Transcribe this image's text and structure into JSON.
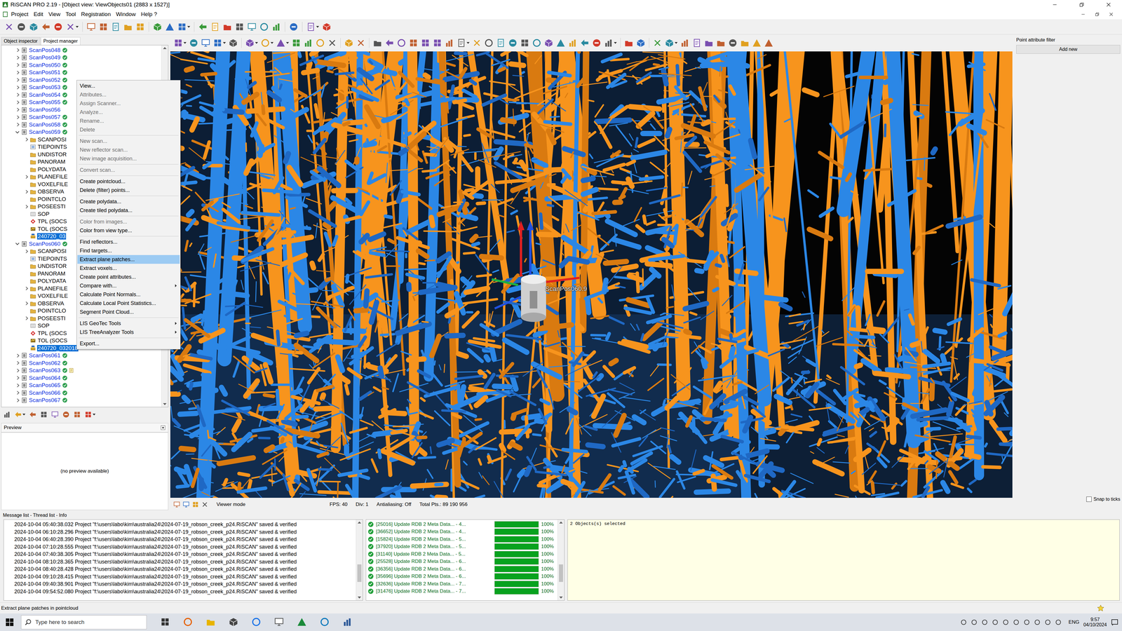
{
  "window": {
    "title": "RiSCAN PRO 2.19 - [Object view: ViewObjects01 (2883 x 1527)]"
  },
  "menu": [
    "Project",
    "Edit",
    "View",
    "Tool",
    "Registration",
    "Window",
    "Help ?"
  ],
  "left_tabs": [
    {
      "label": "Object inspector",
      "selected": false
    },
    {
      "label": "Project manager",
      "selected": true
    }
  ],
  "tree": [
    {
      "label": "ScanPos048",
      "depth": 0,
      "kind": "scanpos",
      "expandable": true,
      "expanded": false,
      "selected": false,
      "registered": true,
      "annotated": false
    },
    {
      "label": "ScanPos049",
      "depth": 0,
      "kind": "scanpos",
      "expandable": true,
      "expanded": false,
      "selected": false,
      "registered": true,
      "annotated": false
    },
    {
      "label": "ScanPos050",
      "depth": 0,
      "kind": "scanpos",
      "expandable": true,
      "expanded": false,
      "selected": false,
      "registered": true,
      "annotated": false
    },
    {
      "label": "ScanPos051",
      "depth": 0,
      "kind": "scanpos",
      "expandable": true,
      "expanded": false,
      "selected": false,
      "registered": true,
      "annotated": false
    },
    {
      "label": "ScanPos052",
      "depth": 0,
      "kind": "scanpos",
      "expandable": true,
      "expanded": false,
      "selected": false,
      "registered": true,
      "annotated": false
    },
    {
      "label": "ScanPos053",
      "depth": 0,
      "kind": "scanpos",
      "expandable": true,
      "expanded": false,
      "selected": false,
      "registered": true,
      "annotated": false
    },
    {
      "label": "ScanPos054",
      "depth": 0,
      "kind": "scanpos",
      "expandable": true,
      "expanded": false,
      "selected": false,
      "registered": true,
      "annotated": false
    },
    {
      "label": "ScanPos055",
      "depth": 0,
      "kind": "scanpos",
      "expandable": true,
      "expanded": false,
      "selected": false,
      "registered": true,
      "annotated": false
    },
    {
      "label": "ScanPos056",
      "depth": 0,
      "kind": "scanpos",
      "expandable": true,
      "expanded": false,
      "selected": false,
      "registered": false,
      "annotated": false
    },
    {
      "label": "ScanPos057",
      "depth": 0,
      "kind": "scanpos",
      "expandable": true,
      "expanded": false,
      "selected": false,
      "registered": true,
      "annotated": false
    },
    {
      "label": "ScanPos058",
      "depth": 0,
      "kind": "scanpos",
      "expandable": true,
      "expanded": false,
      "selected": false,
      "registered": true,
      "annotated": false
    },
    {
      "label": "ScanPos059",
      "depth": 0,
      "kind": "scanpos",
      "expandable": true,
      "expanded": true,
      "selected": false,
      "registered": true,
      "annotated": false
    },
    {
      "label": "SCANPOSI",
      "depth": 1,
      "kind": "folder",
      "expandable": true,
      "expanded": false,
      "selected": false
    },
    {
      "label": "TIEPOINTS",
      "depth": 1,
      "kind": "list",
      "expandable": false,
      "expanded": false,
      "selected": false
    },
    {
      "label": "UNDISTOR",
      "depth": 1,
      "kind": "folder",
      "expandable": false,
      "expanded": false,
      "selected": false
    },
    {
      "label": "PANORAM",
      "depth": 1,
      "kind": "folder",
      "expandable": false,
      "expanded": false,
      "selected": false
    },
    {
      "label": "POLYDATA",
      "depth": 1,
      "kind": "folder",
      "expandable": false,
      "expanded": false,
      "selected": false
    },
    {
      "label": "PLANEFILE",
      "depth": 1,
      "kind": "folder",
      "expandable": true,
      "expanded": false,
      "selected": false
    },
    {
      "label": "VOXELFILE",
      "depth": 1,
      "kind": "folder",
      "expandable": false,
      "expanded": false,
      "selected": false
    },
    {
      "label": "OBSERVA",
      "depth": 1,
      "kind": "folder",
      "expandable": true,
      "expanded": false,
      "selected": false
    },
    {
      "label": "POINTCLO",
      "depth": 1,
      "kind": "folder",
      "expandable": false,
      "expanded": false,
      "selected": false
    },
    {
      "label": "POSEESTI",
      "depth": 1,
      "kind": "folder",
      "expandable": true,
      "expanded": false,
      "selected": false
    },
    {
      "label": "SOP",
      "depth": 1,
      "kind": "matrix",
      "expandable": false,
      "expanded": false,
      "selected": false
    },
    {
      "label": "TPL (SOCS",
      "depth": 1,
      "kind": "tpl",
      "expandable": false,
      "expanded": false,
      "selected": false
    },
    {
      "label": "TOL (SOCS",
      "depth": 1,
      "kind": "tol",
      "expandable": false,
      "expanded": false,
      "selected": false
    },
    {
      "label": "240720_03",
      "depth": 1,
      "kind": "scan",
      "expandable": false,
      "expanded": false,
      "selected": true
    },
    {
      "label": "ScanPos060",
      "depth": 0,
      "kind": "scanpos",
      "expandable": true,
      "expanded": true,
      "selected": false,
      "registered": true,
      "annotated": false
    },
    {
      "label": "SCANPOSI",
      "depth": 1,
      "kind": "folder",
      "expandable": true,
      "expanded": false,
      "selected": false
    },
    {
      "label": "TIEPOINTS",
      "depth": 1,
      "kind": "list",
      "expandable": false,
      "expanded": false,
      "selected": false
    },
    {
      "label": "UNDISTOR",
      "depth": 1,
      "kind": "folder",
      "expandable": false,
      "expanded": false,
      "selected": false
    },
    {
      "label": "PANORAM",
      "depth": 1,
      "kind": "folder",
      "expandable": false,
      "expanded": false,
      "selected": false
    },
    {
      "label": "POLYDATA",
      "depth": 1,
      "kind": "folder",
      "expandable": false,
      "expanded": false,
      "selected": false
    },
    {
      "label": "PLANEFILE",
      "depth": 1,
      "kind": "folder",
      "expandable": true,
      "expanded": false,
      "selected": false
    },
    {
      "label": "VOXELFILE",
      "depth": 1,
      "kind": "folder",
      "expandable": false,
      "expanded": false,
      "selected": false
    },
    {
      "label": "OBSERVA",
      "depth": 1,
      "kind": "folder",
      "expandable": true,
      "expanded": false,
      "selected": false
    },
    {
      "label": "POINTCLO",
      "depth": 1,
      "kind": "folder",
      "expandable": false,
      "expanded": false,
      "selected": false
    },
    {
      "label": "POSEESTI",
      "depth": 1,
      "kind": "folder",
      "expandable": true,
      "expanded": false,
      "selected": false
    },
    {
      "label": "SOP",
      "depth": 1,
      "kind": "matrix",
      "expandable": false,
      "expanded": false,
      "selected": false
    },
    {
      "label": "TPL (SOCS",
      "depth": 1,
      "kind": "tpl",
      "expandable": false,
      "expanded": false,
      "selected": false
    },
    {
      "label": "TOL (SOCS",
      "depth": 1,
      "kind": "tol",
      "expandable": false,
      "expanded": false,
      "selected": false
    },
    {
      "label": "240720_032018",
      "depth": 1,
      "kind": "scan",
      "expandable": false,
      "expanded": false,
      "selected": true
    },
    {
      "label": "ScanPos061",
      "depth": 0,
      "kind": "scanpos",
      "expandable": true,
      "expanded": false,
      "selected": false,
      "registered": true,
      "annotated": false
    },
    {
      "label": "ScanPos062",
      "depth": 0,
      "kind": "scanpos",
      "expandable": true,
      "expanded": false,
      "selected": false,
      "registered": true,
      "annotated": false
    },
    {
      "label": "ScanPos063",
      "depth": 0,
      "kind": "scanpos",
      "expandable": true,
      "expanded": false,
      "selected": false,
      "registered": true,
      "annotated": true
    },
    {
      "label": "ScanPos064",
      "depth": 0,
      "kind": "scanpos",
      "expandable": true,
      "expanded": false,
      "selected": false,
      "registered": true,
      "annotated": false
    },
    {
      "label": "ScanPos065",
      "depth": 0,
      "kind": "scanpos",
      "expandable": true,
      "expanded": false,
      "selected": false,
      "registered": true,
      "annotated": false
    },
    {
      "label": "ScanPos066",
      "depth": 0,
      "kind": "scanpos",
      "expandable": true,
      "expanded": false,
      "selected": false,
      "registered": true,
      "annotated": false
    },
    {
      "label": "ScanPos067",
      "depth": 0,
      "kind": "scanpos",
      "expandable": true,
      "expanded": false,
      "selected": false,
      "registered": true,
      "annotated": false
    }
  ],
  "context_menu": [
    {
      "kind": "item",
      "label": "View...",
      "disabled": false,
      "selected": false,
      "submenu": false
    },
    {
      "kind": "item",
      "label": "Attributes...",
      "disabled": true,
      "selected": false,
      "submenu": false
    },
    {
      "kind": "item",
      "label": "Assign Scanner...",
      "disabled": true,
      "selected": false,
      "submenu": false
    },
    {
      "kind": "item",
      "label": "Analyze...",
      "disabled": true,
      "selected": false,
      "submenu": false
    },
    {
      "kind": "item",
      "label": "Rename...",
      "disabled": true,
      "selected": false,
      "submenu": false
    },
    {
      "kind": "item",
      "label": "Delete",
      "disabled": true,
      "selected": false,
      "submenu": false
    },
    {
      "kind": "separator"
    },
    {
      "kind": "item",
      "label": "New scan...",
      "disabled": true,
      "selected": false,
      "submenu": false
    },
    {
      "kind": "item",
      "label": "New reflector scan...",
      "disabled": true,
      "selected": false,
      "submenu": false
    },
    {
      "kind": "item",
      "label": "New image acquisition...",
      "disabled": true,
      "selected": false,
      "submenu": false
    },
    {
      "kind": "separator"
    },
    {
      "kind": "item",
      "label": "Convert scan...",
      "disabled": true,
      "selected": false,
      "submenu": false
    },
    {
      "kind": "separator"
    },
    {
      "kind": "item",
      "label": "Create pointcloud...",
      "disabled": false,
      "selected": false,
      "submenu": false
    },
    {
      "kind": "item",
      "label": "Delete (filter) points...",
      "disabled": false,
      "selected": false,
      "submenu": false
    },
    {
      "kind": "separator"
    },
    {
      "kind": "item",
      "label": "Create polydata...",
      "disabled": false,
      "selected": false,
      "submenu": false
    },
    {
      "kind": "item",
      "label": "Create tiled polydata...",
      "disabled": false,
      "selected": false,
      "submenu": false
    },
    {
      "kind": "separator"
    },
    {
      "kind": "item",
      "label": "Color from images...",
      "disabled": true,
      "selected": false,
      "submenu": false
    },
    {
      "kind": "item",
      "label": "Color from view type...",
      "disabled": false,
      "selected": false,
      "submenu": false
    },
    {
      "kind": "separator"
    },
    {
      "kind": "item",
      "label": "Find reflectors...",
      "disabled": false,
      "selected": false,
      "submenu": false
    },
    {
      "kind": "item",
      "label": "Find targets...",
      "disabled": false,
      "selected": false,
      "submenu": false
    },
    {
      "kind": "item",
      "label": "Extract plane patches...",
      "disabled": false,
      "selected": true,
      "submenu": false
    },
    {
      "kind": "item",
      "label": "Extract voxels...",
      "disabled": false,
      "selected": false,
      "submenu": false
    },
    {
      "kind": "item",
      "label": "Create point attributes...",
      "disabled": false,
      "selected": false,
      "submenu": false
    },
    {
      "kind": "item",
      "label": "Compare with...",
      "disabled": false,
      "selected": false,
      "submenu": true
    },
    {
      "kind": "item",
      "label": "Calculate Point Normals...",
      "disabled": false,
      "selected": false,
      "submenu": false
    },
    {
      "kind": "item",
      "label": "Calculate Local Point Statistics...",
      "disabled": false,
      "selected": false,
      "submenu": false
    },
    {
      "kind": "item",
      "label": "Segment Point Cloud...",
      "disabled": false,
      "selected": false,
      "submenu": false
    },
    {
      "kind": "separator"
    },
    {
      "kind": "item",
      "label": "LIS GeoTec Tools",
      "disabled": false,
      "selected": false,
      "submenu": true
    },
    {
      "kind": "item",
      "label": "LIS TreeAnalyzer Tools",
      "disabled": false,
      "selected": false,
      "submenu": true
    },
    {
      "kind": "separator"
    },
    {
      "kind": "item",
      "label": "Export...",
      "disabled": false,
      "selected": false,
      "submenu": false
    }
  ],
  "viewport": {
    "scanner_label": "ScanPos060.9"
  },
  "viewport_status": {
    "mode": "Viewer mode",
    "fps": "FPS: 40",
    "div": "Div: 1",
    "antialiasing": "Antialiasing: Off",
    "total_points": "Total Pts.: 89 190 956"
  },
  "right_panel": {
    "title": "Point attribute filter",
    "button": "Add new",
    "snap": {
      "label": "Snap to ticks",
      "checked": false
    }
  },
  "preview": {
    "title": "Preview",
    "empty": "(no preview available)"
  },
  "bottom_label": "Message list - Thread list - Info",
  "messages": [
    "2024-10-04 05:40:38.032 Project \"f:\\users\\labo\\kim\\australia24\\2024-07-19_robson_creek_p24.RiSCAN\" saved & verified",
    "2024-10-04 06:10:28.296 Project \"f:\\users\\labo\\kim\\australia24\\2024-07-19_robson_creek_p24.RiSCAN\" saved & verified",
    "2024-10-04 06:40:28.390 Project \"f:\\users\\labo\\kim\\australia24\\2024-07-19_robson_creek_p24.RiSCAN\" saved & verified",
    "2024-10-04 07:10:28.555 Project \"f:\\users\\labo\\kim\\australia24\\2024-07-19_robson_creek_p24.RiSCAN\" saved & verified",
    "2024-10-04 07:40:38.305 Project \"f:\\users\\labo\\kim\\australia24\\2024-07-19_robson_creek_p24.RiSCAN\" saved & verified",
    "2024-10-04 08:10:28.365 Project \"f:\\users\\labo\\kim\\australia24\\2024-07-19_robson_creek_p24.RiSCAN\" saved & verified",
    "2024-10-04 08:40:28.428 Project \"f:\\users\\labo\\kim\\australia24\\2024-07-19_robson_creek_p24.RiSCAN\" saved & verified",
    "2024-10-04 09:10:28.415 Project \"f:\\users\\labo\\kim\\australia24\\2024-07-19_robson_creek_p24.RiSCAN\" saved & verified",
    "2024-10-04 09:40:38.901 Project \"f:\\users\\labo\\kim\\australia24\\2024-07-19_robson_creek_p24.RiSCAN\" saved & verified",
    "2024-10-04 09:54:52.080 Project \"f:\\users\\labo\\kim\\australia24\\2024-07-19_robson_creek_p24.RiSCAN\" saved & verified"
  ],
  "threads": [
    {
      "text": "[25016] Update RDB 2 Meta Data... - 4...",
      "level": 1,
      "percent": "100%",
      "done": true
    },
    {
      "text": "[36652] Update RDB 2 Meta Data... - 4...",
      "level": 1,
      "percent": "100%",
      "done": true
    },
    {
      "text": "[15824] Update RDB 2 Meta Data... - 5...",
      "level": 1,
      "percent": "100%",
      "done": true
    },
    {
      "text": "[37920] Update RDB 2 Meta Data... - 5...",
      "level": 1,
      "percent": "100%",
      "done": true
    },
    {
      "text": "[31140] Update RDB 2 Meta Data... - 5...",
      "level": 1,
      "percent": "100%",
      "done": true
    },
    {
      "text": "[25528] Update RDB 2 Meta Data... - 6...",
      "level": 1,
      "percent": "100%",
      "done": true
    },
    {
      "text": "[36356] Update RDB 2 Meta Data... - 6...",
      "level": 1,
      "percent": "100%",
      "done": true
    },
    {
      "text": "[35696] Update RDB 2 Meta Data... - 6...",
      "level": 1,
      "percent": "100%",
      "done": true
    },
    {
      "text": "[32636] Update RDB 2 Meta Data... - 7...",
      "level": 1,
      "percent": "100%",
      "done": true
    },
    {
      "text": "[31476] Update RDB 2 Meta Data... - 7...",
      "level": 1,
      "percent": "100%",
      "done": true
    }
  ],
  "info": {
    "text": "2 Objects(s) selected"
  },
  "status_bar": "Extract plane patches in pointcloud",
  "taskbar": {
    "search_placeholder": "Type here to search",
    "language": "ENG",
    "time": "9:57",
    "date": "04/10/2024"
  }
}
